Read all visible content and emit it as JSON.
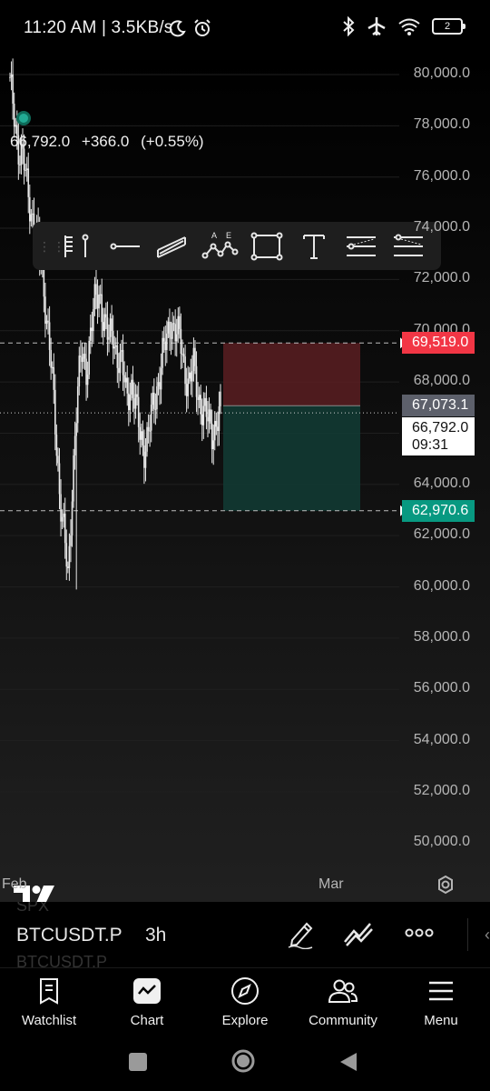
{
  "status_bar": {
    "time": "11:20 AM | 3.5KB/s",
    "battery": "2",
    "icons": [
      "moon-icon",
      "alarm-icon",
      "bluetooth-icon",
      "airplane-icon",
      "wifi-icon",
      "battery-icon"
    ]
  },
  "quote": {
    "last": "66,792.0",
    "change": "+366.0",
    "change_pct": "(+0.55%)"
  },
  "drawing_toolbar": {
    "tools": [
      "grip-handle",
      "flag-line-tool",
      "horizontal-line-tool",
      "channel-tool",
      "pattern-tool",
      "rectangle-tool",
      "text-tool",
      "long-position-tool",
      "short-position-tool"
    ]
  },
  "chart_data": {
    "type": "candlestick",
    "symbol": "BTCUSDT.P",
    "interval": "3h",
    "y_axis_ticks": [
      "80,000.0",
      "78,000.0",
      "76,000.0",
      "74,000.0",
      "72,000.0",
      "70,000.0",
      "68,000.0",
      "66,000.0",
      "64,000.0",
      "62,000.0",
      "60,000.0",
      "58,000.0",
      "56,000.0",
      "54,000.0",
      "52,000.0",
      "50,000.0"
    ],
    "ylim": [
      49500,
      81000
    ],
    "x_axis_labels": [
      "Feb",
      "Mar"
    ],
    "position_tool": {
      "stop": 69519.0,
      "entry": 67073.1,
      "target": 62970.6
    },
    "price_tags": {
      "stop": "69,519.0",
      "entry": "67,073.1",
      "last": "66,792.0",
      "countdown": "09:31",
      "target": "62,970.6"
    },
    "approx_close_path": [
      79500,
      78500,
      77000,
      76500,
      75500,
      74500,
      73500,
      72500,
      71000,
      69000,
      66500,
      64000,
      62200,
      60000,
      64500,
      67500,
      69000,
      68500,
      70000,
      71000,
      71500,
      70500,
      69500,
      70000,
      69000,
      68500,
      67500,
      68000,
      67000,
      66000,
      65500,
      66000,
      67000,
      68000,
      69000,
      69500,
      70500,
      70000,
      69500,
      68500,
      68000,
      68500,
      67500,
      67000,
      66500,
      66000,
      66500,
      66792
    ]
  },
  "bottom_bar": {
    "ghost_above": "SPX",
    "symbol": "BTCUSDT.P",
    "interval": "3h",
    "ghost_below": "BTCUSDT.P",
    "chevron": "‹"
  },
  "nav": [
    {
      "label": "Watchlist",
      "icon": "watchlist-icon"
    },
    {
      "label": "Chart",
      "icon": "chart-icon"
    },
    {
      "label": "Explore",
      "icon": "compass-icon"
    },
    {
      "label": "Community",
      "icon": "community-icon"
    },
    {
      "label": "Menu",
      "icon": "menu-icon"
    }
  ],
  "colors": {
    "stop_red": "#f23645",
    "target_green": "#089981",
    "entry_gray": "#5d606b",
    "live_dot": "#22ab94"
  }
}
